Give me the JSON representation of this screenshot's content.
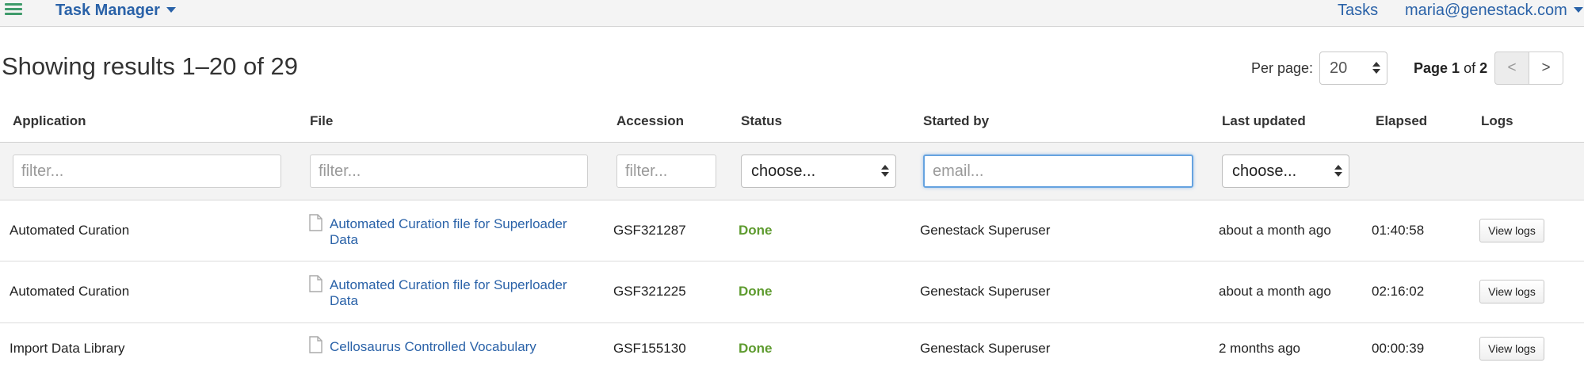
{
  "topbar": {
    "app_name": "Task Manager",
    "tasks_link": "Tasks",
    "user_email": "maria@genestack.com"
  },
  "results": {
    "summary": "Showing results 1–20 of 29",
    "per_page_label": "Per page:",
    "per_page_value": "20",
    "page_word": "Page",
    "page_current": "1",
    "page_of": "of",
    "page_total": "2",
    "prev_label": "<",
    "next_label": ">"
  },
  "table": {
    "columns": [
      "Application",
      "File",
      "Accession",
      "Status",
      "Started by",
      "Last updated",
      "Elapsed",
      "Logs"
    ],
    "filters": {
      "application_placeholder": "filter...",
      "file_placeholder": "filter...",
      "accession_placeholder": "filter...",
      "status_value": "choose...",
      "started_by_placeholder": "email...",
      "last_updated_value": "choose..."
    },
    "rows": [
      {
        "application": "Automated Curation",
        "file_line1": "Automated Curation file for Superloader",
        "file_line2": "Data",
        "accession": "GSF321287",
        "status": "Done",
        "started_by": "Genestack Superuser",
        "last_updated": "about a month ago",
        "elapsed": "01:40:58",
        "logs_button": "View logs"
      },
      {
        "application": "Automated Curation",
        "file_line1": "Automated Curation file for Superloader",
        "file_line2": "Data",
        "accession": "GSF321225",
        "status": "Done",
        "started_by": "Genestack Superuser",
        "last_updated": "about a month ago",
        "elapsed": "02:16:02",
        "logs_button": "View logs"
      },
      {
        "application": "Import Data Library",
        "file_line1": "Cellosaurus Controlled Vocabulary",
        "file_line2": "",
        "accession": "GSF155130",
        "status": "Done",
        "started_by": "Genestack Superuser",
        "last_updated": "2 months ago",
        "elapsed": "00:00:39",
        "logs_button": "View logs"
      }
    ]
  },
  "colors": {
    "link": "#2a62a8",
    "status_done": "#5e9b2f",
    "menu_icon": "#3f9b6b",
    "focus": "#66a3e0"
  },
  "icons": [
    "hamburger-menu-icon",
    "chevron-down-icon",
    "file-icon",
    "select-arrows-icon"
  ]
}
